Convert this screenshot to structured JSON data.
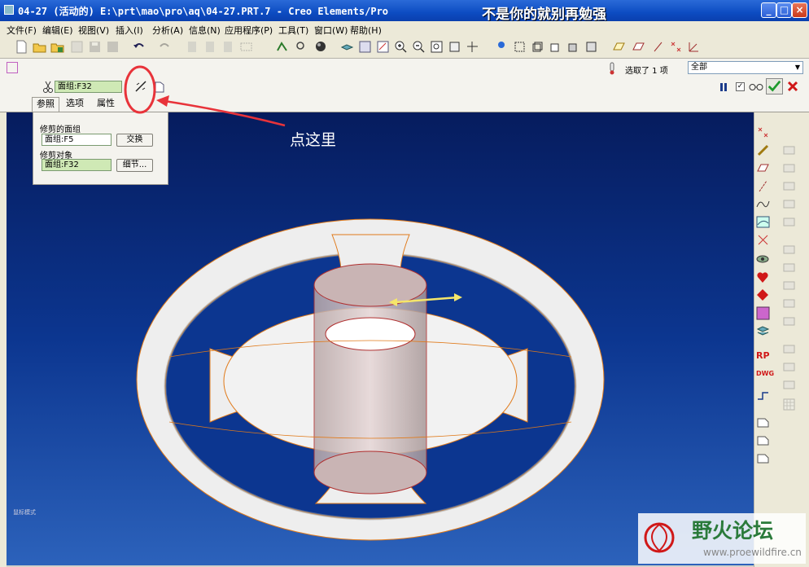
{
  "window": {
    "title": "04-27 (活动的) E:\\prt\\mao\\pro\\aq\\04-27.PRT.7 - Creo Elements/Pro",
    "overlay_caption": "不是你的就别再勉强"
  },
  "menu": [
    "文件(F)",
    "编辑(E)",
    "视图(V)",
    "插入(I)",
    "分析(A)",
    "信息(N)",
    "应用程序(P)",
    "工具(T)",
    "窗口(W)",
    "帮助(H)"
  ],
  "dashboard": {
    "trim_quilt_value": "面组:F32",
    "selection_status": "选取了 1 项",
    "filter_value": "全部",
    "tabs": [
      "参照",
      "选项",
      "属性"
    ]
  },
  "references_panel": {
    "trimmed_quilt_label": "修剪的面组",
    "trimmed_quilt_value": "面组:F5",
    "swap_button": "交换",
    "trim_object_label": "修剪对象",
    "trim_object_value": "面组:F32",
    "details_button": "细节..."
  },
  "annotation": {
    "callout_text": "点这里",
    "color": "#e8333a"
  },
  "viewport": {
    "corner_label": "鼠标模式"
  },
  "watermark": {
    "text": "野火论坛",
    "url": "www.proewildfire.cn"
  },
  "colors": {
    "titlebar": "#0d4cc2",
    "viewport_top": "#061c5e",
    "viewport_bottom": "#2c62bb",
    "quilt_highlight": "#cfe9b5",
    "edge_orange": "#e07a1a",
    "ok_green": "#1e9a2c",
    "cancel_red": "#d01818"
  }
}
